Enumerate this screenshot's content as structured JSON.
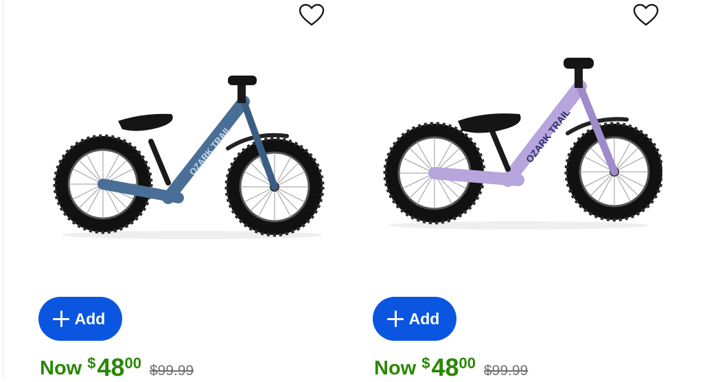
{
  "products": [
    {
      "name": "Ozark Trail balance bike - blue",
      "bike_label": "OZARK TRAIL",
      "frame_color": "#4a6f97",
      "frame_shade": "#3b5d82",
      "add_label": "Add",
      "price": {
        "prefix": "Now",
        "currency": "$",
        "dollars": "48",
        "cents": "00",
        "was": "$99.99"
      }
    },
    {
      "name": "Ozark Trail balance bike - purple",
      "bike_label": "OZARK TRAIL",
      "frame_color": "#b7a6dd",
      "frame_shade": "#9e8bc9",
      "add_label": "Add",
      "price": {
        "prefix": "Now",
        "currency": "$",
        "dollars": "48",
        "cents": "00",
        "was": "$99.99"
      }
    }
  ],
  "colors": {
    "accent": "#0a56e0",
    "price_green": "#2a8703",
    "was_gray": "#6d6e71"
  },
  "icons": {
    "favorite": "heart-outline-icon",
    "add": "plus-icon"
  }
}
